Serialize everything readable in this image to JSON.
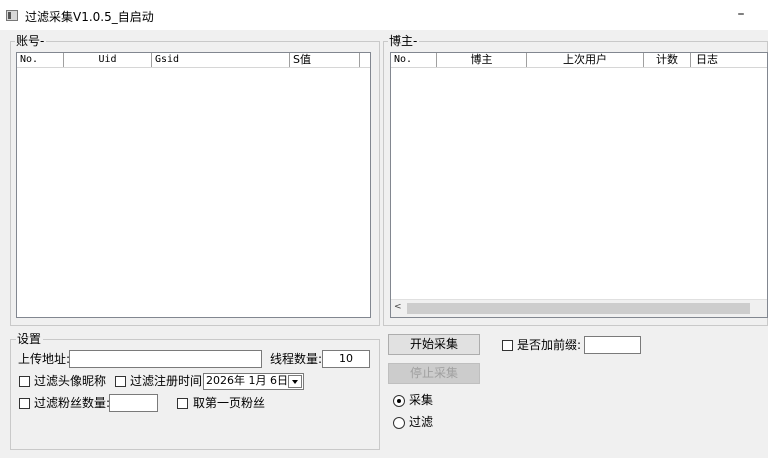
{
  "window": {
    "title": "过滤采集V1.0.5_自启动",
    "minimize_symbol": "–"
  },
  "accounts": {
    "group_label": "账号",
    "columns": [
      "No.",
      "Uid",
      "Gsid",
      "S值"
    ]
  },
  "bloggers": {
    "group_label": "博主",
    "columns": [
      "No.",
      "博主",
      "上次用户",
      "计数",
      "日志"
    ],
    "scroll_left_symbol": "<"
  },
  "settings": {
    "group_label": "设置",
    "upload_label": "上传地址:",
    "upload_value": "",
    "threads_label": "线程数量:",
    "threads_value": "10",
    "filter_avatar_label": "过滤头像昵称",
    "filter_regtime_label": "过滤注册时间:",
    "regtime_value": "2026年 1月 6日",
    "filter_fans_label": "过滤粉丝数量:",
    "fans_value": "",
    "first_page_label": "取第一页粉丝"
  },
  "controls": {
    "start_label": "开始采集",
    "stop_label": "停止采集",
    "prefix_label": "是否加前缀:",
    "prefix_value": "",
    "mode_collect_label": "采集",
    "mode_filter_label": "过滤",
    "mode_selected": "采集"
  }
}
